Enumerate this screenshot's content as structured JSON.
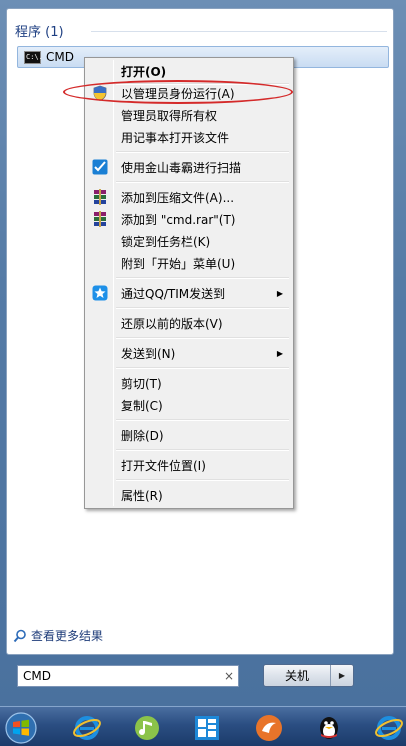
{
  "start_menu": {
    "section_header": "程序 (1)",
    "program": {
      "icon_text": "C:\\.",
      "label": "CMD"
    },
    "see_more": "查看更多结果",
    "search": {
      "value": "CMD",
      "clear": "×"
    },
    "shutdown": {
      "label": "关机",
      "arrow": "▶"
    }
  },
  "context_menu": {
    "items": [
      {
        "label": "打开(O)",
        "bold": true
      },
      {
        "label": "以管理员身份运行(A)",
        "icon": "uac-shield-icon"
      },
      {
        "label": "管理员取得所有权"
      },
      {
        "label": "用记事本打开该文件"
      },
      {
        "label": "使用金山毒霸进行扫描",
        "icon": "kingsoft-antivirus-icon"
      },
      {
        "label": "添加到压缩文件(A)...",
        "icon": "winrar-icon"
      },
      {
        "label": "添加到 \"cmd.rar\"(T)",
        "icon": "winrar-icon"
      },
      {
        "label": "锁定到任务栏(K)"
      },
      {
        "label": "附到「开始」菜单(U)"
      },
      {
        "label": "通过QQ/TIM发送到",
        "icon": "qq-star-icon",
        "submenu": "▶"
      },
      {
        "label": "还原以前的版本(V)"
      },
      {
        "label": "发送到(N)",
        "submenu": "▶"
      },
      {
        "label": "剪切(T)"
      },
      {
        "label": "复制(C)"
      },
      {
        "label": "删除(D)"
      },
      {
        "label": "打开文件位置(I)"
      },
      {
        "label": "属性(R)"
      }
    ]
  },
  "taskbar": {
    "icons": [
      "windows-start-icon",
      "internet-explorer-icon",
      "music-player-icon",
      "start-screen-tiles-icon",
      "media-app-icon",
      "qq-penguin-icon",
      "internet-explorer-icon"
    ]
  },
  "colors": {
    "highlight_ellipse": "#d42a2a",
    "section_header": "#1e3f82",
    "taskbar": "#2b4e82"
  }
}
